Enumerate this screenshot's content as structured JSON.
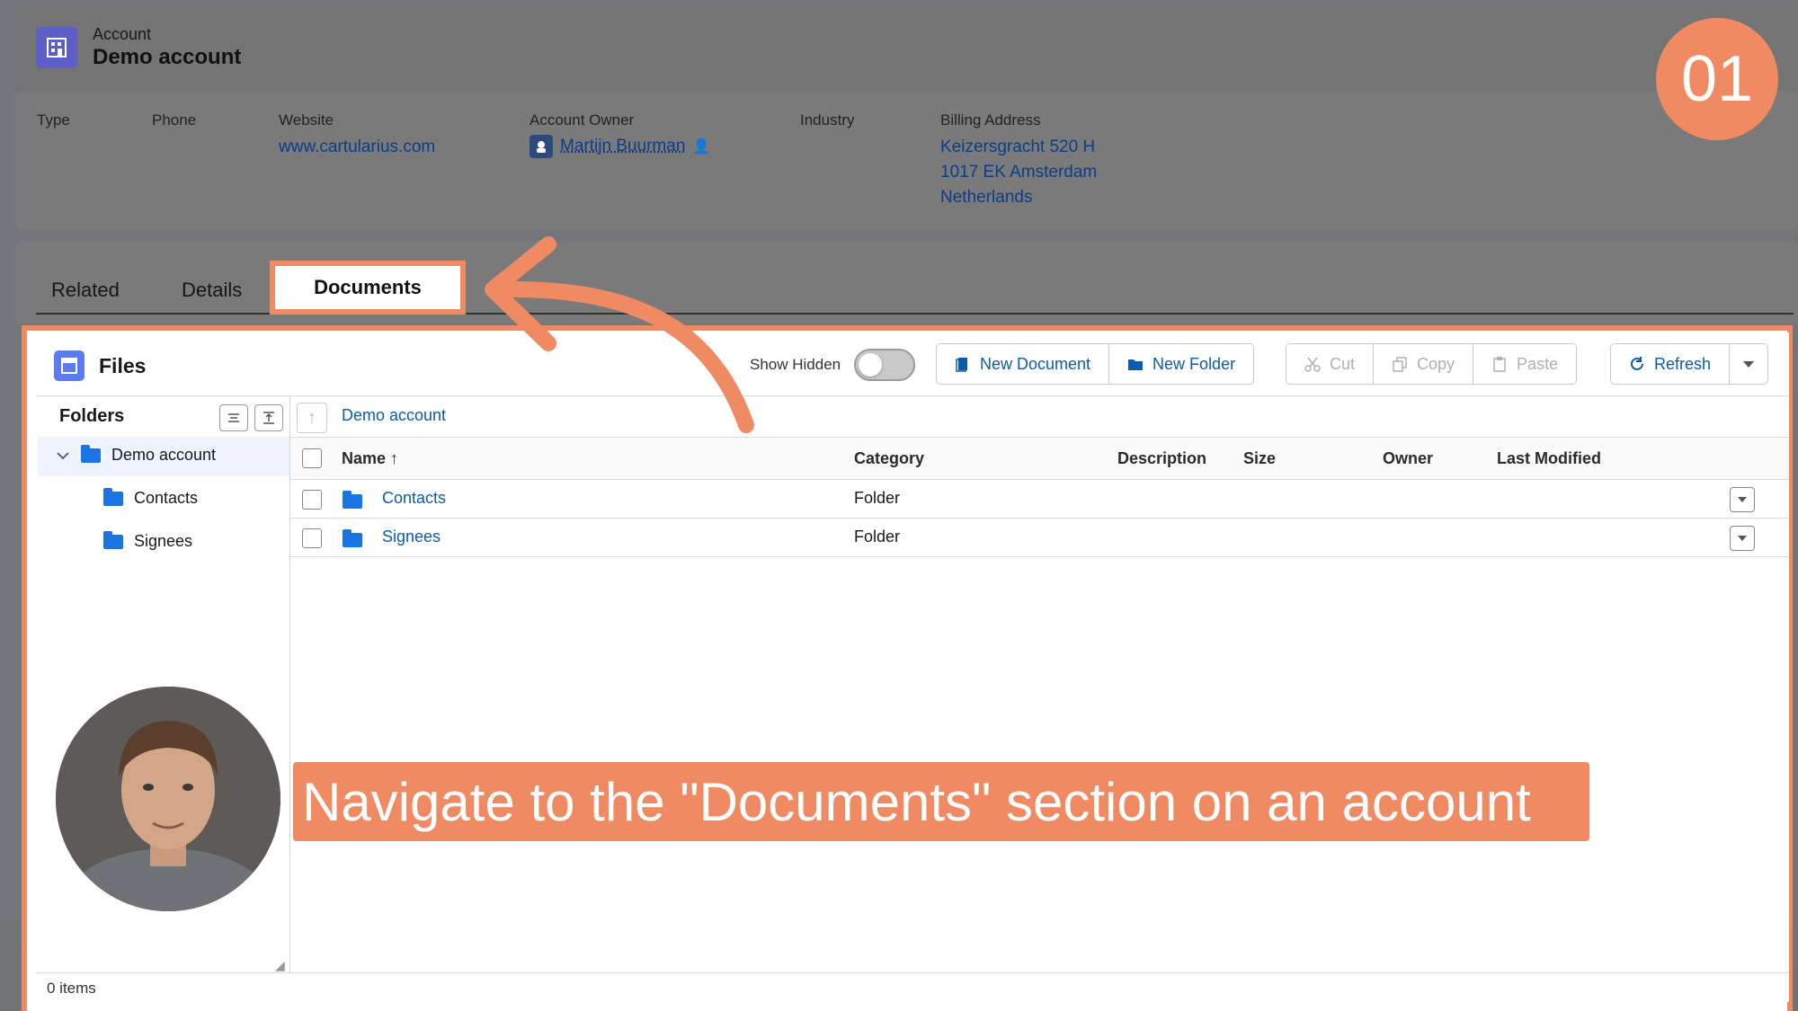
{
  "header": {
    "object_label": "Account",
    "record_name": "Demo account",
    "fields": {
      "type_label": "Type",
      "phone_label": "Phone",
      "website_label": "Website",
      "website_value": "www.cartularius.com",
      "owner_label": "Account Owner",
      "owner_value": "Martijn Buurman",
      "industry_label": "Industry",
      "billing_label": "Billing Address",
      "billing_line1": "Keizersgracht 520 H",
      "billing_line2": "1017 EK Amsterdam",
      "billing_line3": "Netherlands"
    }
  },
  "step_badge": "01",
  "tabs": [
    {
      "label": "Related"
    },
    {
      "label": "Details"
    },
    {
      "label": "Documents"
    }
  ],
  "files": {
    "title": "Files",
    "show_hidden_label": "Show Hidden",
    "show_hidden_on": false,
    "buttons": {
      "new_document": "New Document",
      "new_folder": "New Folder",
      "cut": "Cut",
      "copy": "Copy",
      "paste": "Paste",
      "refresh": "Refresh"
    },
    "folders_heading": "Folders",
    "tree": [
      {
        "label": "Demo account"
      },
      {
        "label": "Contacts"
      },
      {
        "label": "Signees"
      }
    ],
    "breadcrumb": "Demo account",
    "columns": [
      "Name",
      "Category",
      "Description",
      "Size",
      "Owner",
      "Last Modified"
    ],
    "sort_indicator": "↑",
    "rows": [
      {
        "name": "Contacts",
        "category": "Folder"
      },
      {
        "name": "Signees",
        "category": "Folder"
      }
    ],
    "items_count": "0 items"
  },
  "annotation": {
    "caption": "Navigate to the \"Documents\" section on an account",
    "accent_color": "#f08a63"
  }
}
